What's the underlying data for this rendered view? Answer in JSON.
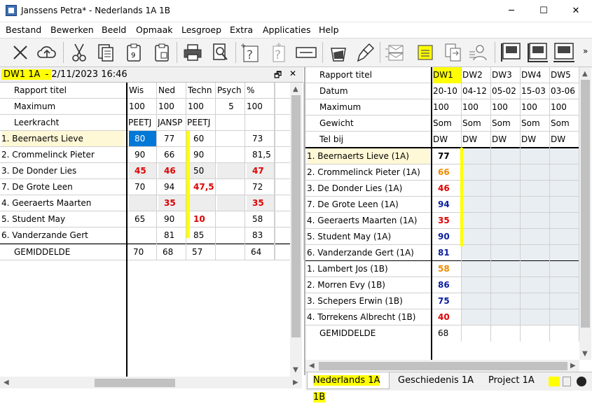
{
  "window": {
    "title": "Janssens Petra* - Nederlands 1A 1B",
    "controls": [
      "─",
      "☐",
      "✕"
    ]
  },
  "menu": [
    "Bestand",
    "Bewerken",
    "Beeld",
    "Opmaak",
    "Lesgroep",
    "Extra",
    "Applicaties",
    "Help"
  ],
  "toolbar": {
    "icons": [
      "close-x-icon",
      "cloud-upload-icon",
      "scissors-icon",
      "copy-icon",
      "paste-9-icon",
      "paste-icon",
      "print-icon",
      "search-doc-icon",
      "help-question-icon",
      "help-question-disabled-icon",
      "form-icon",
      "bucket-icon",
      "brush-icon",
      "mail-icon",
      "notes-icon",
      "transfer-icon",
      "person-card-icon",
      "layout1-icon",
      "layout2-icon",
      "layout3-icon",
      "more-icon"
    ],
    "more": "»"
  },
  "left": {
    "header": {
      "group": "DW1 1A",
      "separator": " - ",
      "datetime": "2/11/2023 16:46",
      "restore": "🗗",
      "close": "✕"
    },
    "row_labels": [
      "Rapport titel",
      "Maximum",
      "Leerkracht"
    ],
    "columns": [
      "Wis",
      "Ned",
      "Techn",
      "Psych",
      "%"
    ],
    "maximum": [
      "100",
      "100",
      "100",
      "5",
      "100"
    ],
    "teachers": [
      "PEETJ",
      "JANSP",
      "PEETJ",
      "",
      ""
    ],
    "students": [
      {
        "name": "1. Beernaerts Lieve",
        "vals": [
          "80",
          "77",
          "60",
          "",
          "73"
        ]
      },
      {
        "name": "2. Crommelinck Pieter",
        "vals": [
          "90",
          "66",
          "90",
          "",
          "81,5"
        ]
      },
      {
        "name": "3. De Donder Lies",
        "vals": [
          "45",
          "46",
          "50",
          "",
          "47"
        ]
      },
      {
        "name": "7. De Grote Leen",
        "vals": [
          "70",
          "94",
          "47,5",
          "",
          "72"
        ]
      },
      {
        "name": "4. Geeraerts Maarten",
        "vals": [
          "",
          "35",
          "",
          "",
          "35"
        ]
      },
      {
        "name": "5. Student May",
        "vals": [
          "65",
          "90",
          "10",
          "",
          "58"
        ]
      },
      {
        "name": "6. Vanderzande Gert",
        "vals": [
          "",
          "81",
          "85",
          "",
          "83"
        ]
      }
    ],
    "average": {
      "label": "GEMIDDELDE",
      "vals": [
        "70",
        "68",
        "57",
        "",
        "64"
      ]
    }
  },
  "right": {
    "row_labels": [
      "Rapport titel",
      "Datum",
      "Maximum",
      "Gewicht",
      "Tel bij"
    ],
    "columns": [
      {
        "title": "DW1",
        "date": "20-10",
        "max": "100",
        "weight": "Som",
        "telbij": "DW"
      },
      {
        "title": "DW2",
        "date": "04-12",
        "max": "100",
        "weight": "Som",
        "telbij": "DW"
      },
      {
        "title": "DW3",
        "date": "05-02",
        "max": "100",
        "weight": "Som",
        "telbij": "DW"
      },
      {
        "title": "DW4",
        "date": "15-03",
        "max": "100",
        "weight": "Som",
        "telbij": "DW"
      },
      {
        "title": "DW5",
        "date": "03-06",
        "max": "100",
        "weight": "Som",
        "telbij": "DW"
      }
    ],
    "students": [
      {
        "name": "1. Beernaerts Lieve (1A)",
        "score": "77",
        "color": "#000000"
      },
      {
        "name": "2. Crommelinck Pieter (1A)",
        "score": "66",
        "color": "#f08a00"
      },
      {
        "name": "3. De Donder Lies (1A)",
        "score": "46",
        "color": "#e00000"
      },
      {
        "name": "7. De Grote Leen (1A)",
        "score": "94",
        "color": "#0a1fa0"
      },
      {
        "name": "4. Geeraerts Maarten (1A)",
        "score": "35",
        "color": "#e00000"
      },
      {
        "name": "5. Student May (1A)",
        "score": "90",
        "color": "#0a1fa0"
      },
      {
        "name": "6. Vanderzande Gert (1A)",
        "score": "81",
        "color": "#0a1fa0"
      },
      {
        "name": "1. Lambert Jos (1B)",
        "score": "58",
        "color": "#f08a00"
      },
      {
        "name": "2. Morren Evy (1B)",
        "score": "86",
        "color": "#0a1fa0"
      },
      {
        "name": "3. Schepers Erwin (1B)",
        "score": "75",
        "color": "#0a1fa0"
      },
      {
        "name": "4. Torrekens Albrecht (1B)",
        "score": "40",
        "color": "#e00000"
      }
    ],
    "average": {
      "label": "GEMIDDELDE",
      "score": "68"
    }
  },
  "tabs": [
    "Nederlands 1A 1B",
    "Geschiedenis 1A",
    "Project 1A"
  ],
  "colors": {
    "highlight": "#ffff00",
    "selected": "#0078d7",
    "red": "#e00000",
    "blue": "#0a1fa0",
    "orange": "#f08a00"
  }
}
